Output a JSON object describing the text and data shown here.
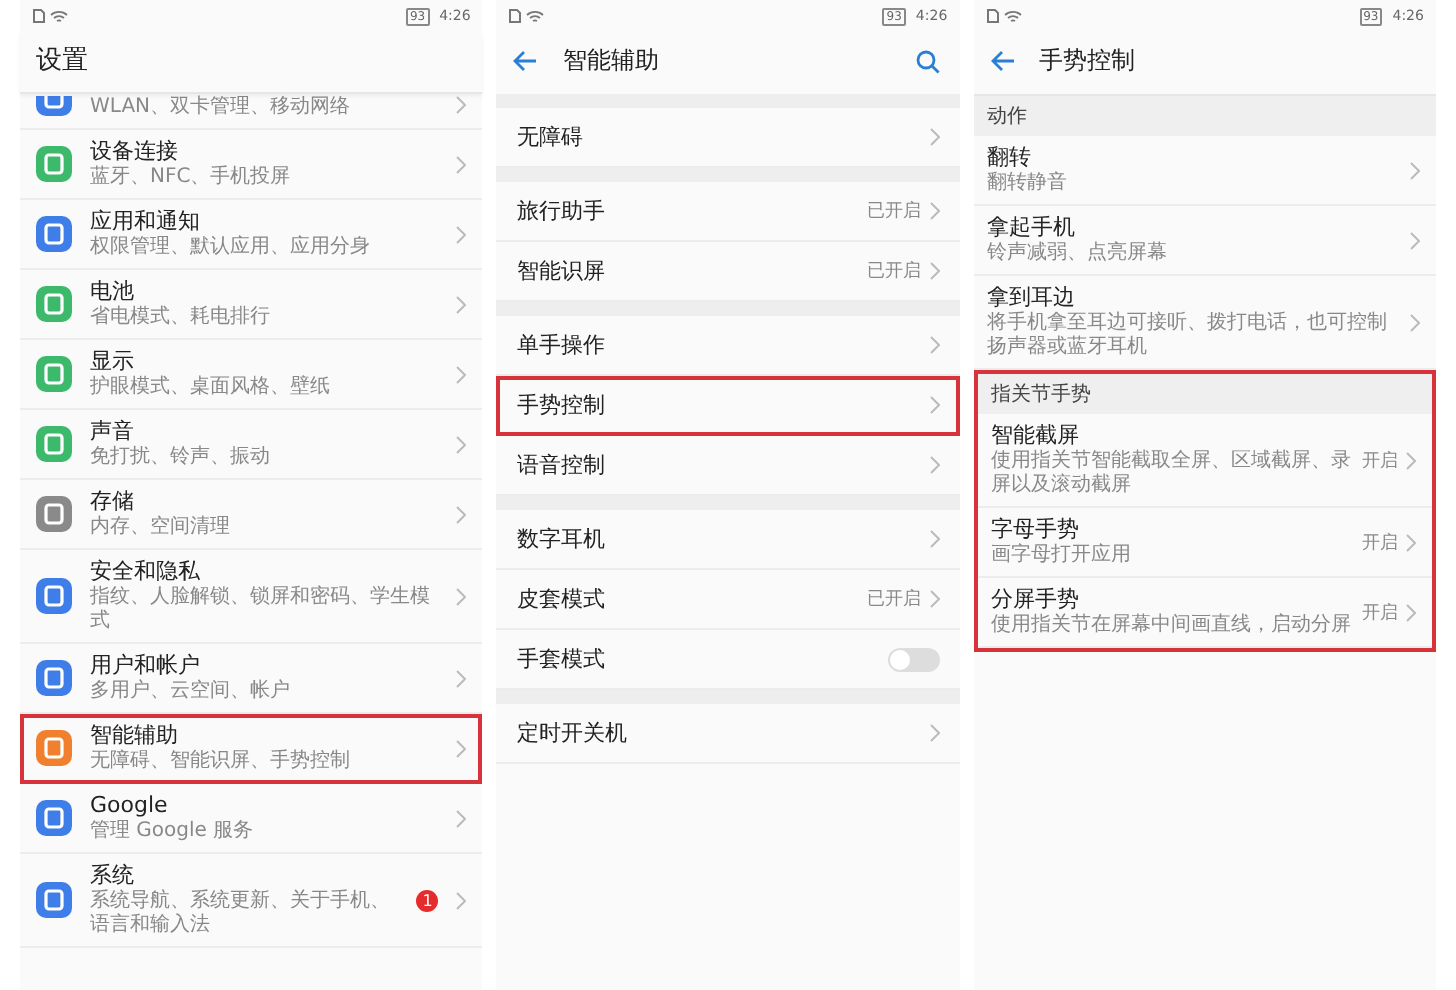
{
  "settings_screen": {
    "status": {
      "battery": "93",
      "time": "4:26"
    },
    "title": "设置",
    "items": [
      {
        "subtitle": "WLAN、双卡管理、移动网络",
        "color": "#3f7ee8",
        "highlighted": false
      },
      {
        "title": "设备连接",
        "subtitle": "蓝牙、NFC、手机投屏",
        "color": "#3cb96b",
        "highlighted": false
      },
      {
        "title": "应用和通知",
        "subtitle": "权限管理、默认应用、应用分身",
        "color": "#3f7ee8",
        "highlighted": false
      },
      {
        "title": "电池",
        "subtitle": "省电模式、耗电排行",
        "color": "#3cb96b",
        "highlighted": false
      },
      {
        "title": "显示",
        "subtitle": "护眼模式、桌面风格、壁纸",
        "color": "#3cb96b",
        "highlighted": false
      },
      {
        "title": "声音",
        "subtitle": "免打扰、铃声、振动",
        "color": "#3cb96b",
        "highlighted": false
      },
      {
        "title": "存储",
        "subtitle": "内存、空间清理",
        "color": "#8a8a8a",
        "highlighted": false
      },
      {
        "title": "安全和隐私",
        "subtitle": "指纹、人脸解锁、锁屏和密码、学生模式",
        "color": "#3f7ee8",
        "highlighted": false
      },
      {
        "title": "用户和帐户",
        "subtitle": "多用户、云空间、帐户",
        "color": "#3f7ee8",
        "highlighted": false
      },
      {
        "title": "智能辅助",
        "subtitle": "无障碍、智能识屏、手势控制",
        "color": "#f0802e",
        "highlighted": true
      },
      {
        "title": "Google",
        "subtitle": "管理 Google 服务",
        "color": "#3f7ee8",
        "highlighted": false
      },
      {
        "title": "系统",
        "subtitle": "系统导航、系统更新、关于手机、语言和输入法",
        "color": "#3f7ee8",
        "highlighted": false,
        "badge": "1"
      }
    ]
  },
  "assist_screen": {
    "status": {
      "battery": "93",
      "time": "4:26"
    },
    "title": "智能辅助",
    "groups": [
      {
        "items": [
          {
            "label": "无障碍",
            "kind": "link",
            "highlighted": false
          }
        ]
      },
      {
        "items": [
          {
            "label": "旅行助手",
            "kind": "link",
            "value": "已开启",
            "highlighted": false
          },
          {
            "label": "智能识屏",
            "kind": "link",
            "value": "已开启",
            "highlighted": false
          }
        ]
      },
      {
        "items": [
          {
            "label": "单手操作",
            "kind": "link",
            "highlighted": false
          },
          {
            "label": "手势控制",
            "kind": "link",
            "highlighted": true
          },
          {
            "label": "语音控制",
            "kind": "link",
            "highlighted": false
          }
        ]
      },
      {
        "items": [
          {
            "label": "数字耳机",
            "kind": "link",
            "highlighted": false
          },
          {
            "label": "皮套模式",
            "kind": "link",
            "value": "已开启",
            "highlighted": false
          },
          {
            "label": "手套模式",
            "kind": "toggle",
            "on": false,
            "highlighted": false
          }
        ]
      },
      {
        "items": [
          {
            "label": "定时开关机",
            "kind": "link",
            "highlighted": false
          }
        ]
      }
    ]
  },
  "gesture_screen": {
    "status": {
      "battery": "93",
      "time": "4:26"
    },
    "title": "手势控制",
    "sections": [
      {
        "header": "动作",
        "highlighted": false,
        "items": [
          {
            "title": "翻转",
            "subtitle": "翻转静音"
          },
          {
            "title": "拿起手机",
            "subtitle": "铃声减弱、点亮屏幕"
          },
          {
            "title": "拿到耳边",
            "subtitle": "将手机拿至耳边可接听、拨打电话，也可控制扬声器或蓝牙耳机"
          }
        ]
      },
      {
        "header": "指关节手势",
        "highlighted": true,
        "items": [
          {
            "title": "智能截屏",
            "subtitle": "使用指关节智能截取全屏、区域截屏、录屏以及滚动截屏",
            "value": "开启"
          },
          {
            "title": "字母手势",
            "subtitle": "画字母打开应用",
            "value": "开启"
          },
          {
            "title": "分屏手势",
            "subtitle": "使用指关节在屏幕中间画直线，启动分屏",
            "value": "开启"
          }
        ]
      }
    ]
  }
}
